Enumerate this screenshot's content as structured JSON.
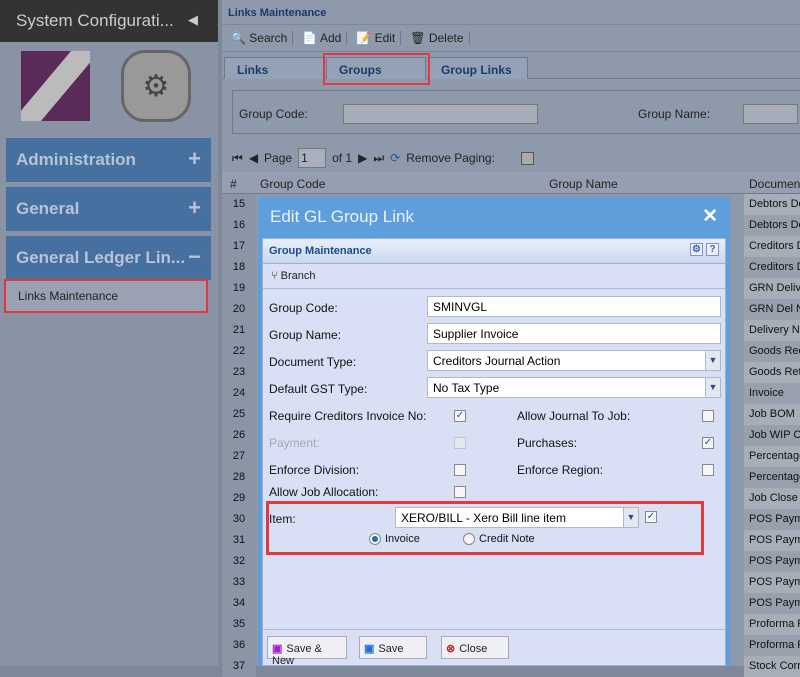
{
  "sidebar": {
    "title": "System Configurati...",
    "collapse_icon": "chevron-left-icon",
    "sections": [
      {
        "label": "Administration",
        "toggle": "+"
      },
      {
        "label": "General",
        "toggle": "+"
      },
      {
        "label": "General Ledger Lin...",
        "toggle": "−"
      }
    ],
    "active_item": "Links Maintenance"
  },
  "main": {
    "title": "Links Maintenance",
    "toolbar": [
      "Search",
      "Add",
      "Edit",
      "Delete"
    ],
    "tabs": [
      "Links",
      "Groups",
      "Group Links"
    ],
    "active_tab": "Groups",
    "filter": {
      "group_code_label": "Group Code:",
      "group_name_label": "Group Name:"
    },
    "pager": {
      "page_label": "Page",
      "page": "1",
      "of": "of 1",
      "remove_paging": "Remove Paging:"
    },
    "grid": {
      "headers": [
        "#",
        "Group Code",
        "Group Name",
        "Document"
      ],
      "rows": [
        {
          "n": "15",
          "doc": "Debtors De"
        },
        {
          "n": "16",
          "doc": "Debtors De"
        },
        {
          "n": "17",
          "doc": "Creditors D"
        },
        {
          "n": "18",
          "doc": "Creditors D"
        },
        {
          "n": "19",
          "doc": "GRN Delive"
        },
        {
          "n": "20",
          "doc": "GRN Del N"
        },
        {
          "n": "21",
          "doc": "Delivery N"
        },
        {
          "n": "22",
          "doc": "Goods Rec"
        },
        {
          "n": "23",
          "doc": "Goods Ret"
        },
        {
          "n": "24",
          "doc": "Invoice"
        },
        {
          "n": "25",
          "doc": "Job BOM"
        },
        {
          "n": "26",
          "doc": "Job WIP C"
        },
        {
          "n": "27",
          "doc": "Percentage"
        },
        {
          "n": "28",
          "doc": "Percentage"
        },
        {
          "n": "29",
          "doc": "Job Close"
        },
        {
          "n": "30",
          "doc": "POS Payme"
        },
        {
          "n": "31",
          "doc": "POS Payme"
        },
        {
          "n": "32",
          "doc": "POS Payme"
        },
        {
          "n": "33",
          "doc": "POS Payme"
        },
        {
          "n": "34",
          "doc": "POS Payme"
        },
        {
          "n": "35",
          "doc": "Proforma P"
        },
        {
          "n": "36",
          "doc": "Proforma P"
        },
        {
          "n": "37",
          "doc": "Stock Corr"
        }
      ]
    }
  },
  "modal": {
    "title": "Edit GL Group Link",
    "panel_title": "Group Maintenance",
    "branch": "Branch",
    "group_code_label": "Group Code:",
    "group_code": "SMINVGL",
    "group_name_label": "Group Name:",
    "group_name": "Supplier Invoice",
    "doc_type_label": "Document Type:",
    "doc_type": "Creditors Journal Action",
    "gst_label": "Default GST Type:",
    "gst": "No Tax Type",
    "req_inv_label": "Require Creditors Invoice No:",
    "req_inv": true,
    "allow_journal_label": "Allow Journal To Job:",
    "allow_journal": false,
    "payment_label": "Payment:",
    "payment": false,
    "purchases_label": "Purchases:",
    "purchases": true,
    "enforce_div_label": "Enforce Division:",
    "enforce_div": false,
    "enforce_region_label": "Enforce Region:",
    "enforce_region": false,
    "allow_job_label": "Allow Job Allocation:",
    "allow_job": false,
    "item_label": "Item:",
    "item": "XERO/BILL - Xero Bill line item",
    "item_checked": true,
    "radio_invoice": "Invoice",
    "radio_credit": "Credit Note",
    "radio_selected": "Invoice",
    "buttons": [
      "Save & New",
      "Save",
      "Close"
    ]
  }
}
